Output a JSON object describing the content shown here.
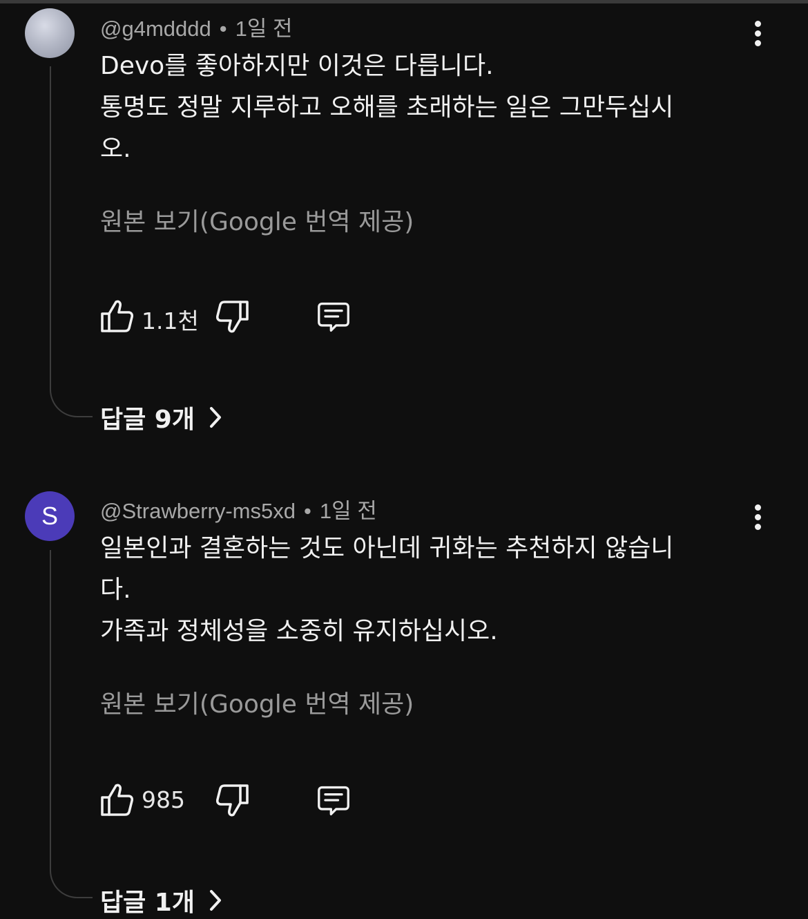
{
  "comments": [
    {
      "author": "@g4mdddd",
      "time": "1일 전",
      "lines": [
        "Devo를 좋아하지만 이것은 다릅니다.",
        "통명도 정말 지루하고 오해를 초래하는 일은 그만두십시",
        "오."
      ],
      "translate_label": "원본 보기(Google 번역 제공)",
      "likes": "1.1천",
      "replies_label": "답글 9개",
      "avatar_letter": ""
    },
    {
      "author": "@Strawberry-ms5xd",
      "time": "1일 전",
      "lines": [
        "일본인과 결혼하는 것도 아닌데 귀화는 추천하지 않습니",
        "다.",
        "가족과 정체성을 소중히 유지하십시오."
      ],
      "translate_label": "원본 보기(Google 번역 제공)",
      "likes": "985",
      "replies_label": "답글 1개",
      "avatar_letter": "S"
    }
  ],
  "separator": "•",
  "icons": {
    "like": "thumb-up-icon",
    "dislike": "thumb-down-icon",
    "reply": "comment-icon",
    "menu": "more-vert-icon",
    "chevron": "chevron-right-icon"
  },
  "colors": {
    "background": "#0f0f0f",
    "avatar_purple": "#4b3bb8",
    "text_primary": "#f1f1f1",
    "text_secondary": "#a8a8a8"
  }
}
